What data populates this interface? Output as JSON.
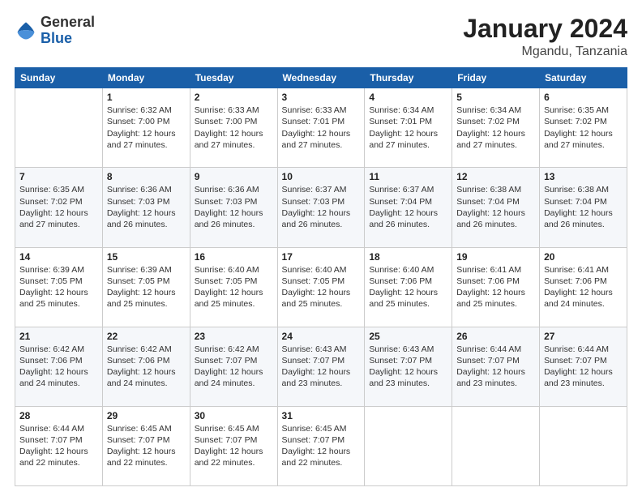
{
  "header": {
    "logo_general": "General",
    "logo_blue": "Blue",
    "month_title": "January 2024",
    "location": "Mgandu, Tanzania"
  },
  "days_of_week": [
    "Sunday",
    "Monday",
    "Tuesday",
    "Wednesday",
    "Thursday",
    "Friday",
    "Saturday"
  ],
  "weeks": [
    [
      {
        "day": "",
        "sunrise": "",
        "sunset": "",
        "daylight": ""
      },
      {
        "day": "1",
        "sunrise": "Sunrise: 6:32 AM",
        "sunset": "Sunset: 7:00 PM",
        "daylight": "Daylight: 12 hours and 27 minutes."
      },
      {
        "day": "2",
        "sunrise": "Sunrise: 6:33 AM",
        "sunset": "Sunset: 7:00 PM",
        "daylight": "Daylight: 12 hours and 27 minutes."
      },
      {
        "day": "3",
        "sunrise": "Sunrise: 6:33 AM",
        "sunset": "Sunset: 7:01 PM",
        "daylight": "Daylight: 12 hours and 27 minutes."
      },
      {
        "day": "4",
        "sunrise": "Sunrise: 6:34 AM",
        "sunset": "Sunset: 7:01 PM",
        "daylight": "Daylight: 12 hours and 27 minutes."
      },
      {
        "day": "5",
        "sunrise": "Sunrise: 6:34 AM",
        "sunset": "Sunset: 7:02 PM",
        "daylight": "Daylight: 12 hours and 27 minutes."
      },
      {
        "day": "6",
        "sunrise": "Sunrise: 6:35 AM",
        "sunset": "Sunset: 7:02 PM",
        "daylight": "Daylight: 12 hours and 27 minutes."
      }
    ],
    [
      {
        "day": "7",
        "sunrise": "Sunrise: 6:35 AM",
        "sunset": "Sunset: 7:02 PM",
        "daylight": "Daylight: 12 hours and 27 minutes."
      },
      {
        "day": "8",
        "sunrise": "Sunrise: 6:36 AM",
        "sunset": "Sunset: 7:03 PM",
        "daylight": "Daylight: 12 hours and 26 minutes."
      },
      {
        "day": "9",
        "sunrise": "Sunrise: 6:36 AM",
        "sunset": "Sunset: 7:03 PM",
        "daylight": "Daylight: 12 hours and 26 minutes."
      },
      {
        "day": "10",
        "sunrise": "Sunrise: 6:37 AM",
        "sunset": "Sunset: 7:03 PM",
        "daylight": "Daylight: 12 hours and 26 minutes."
      },
      {
        "day": "11",
        "sunrise": "Sunrise: 6:37 AM",
        "sunset": "Sunset: 7:04 PM",
        "daylight": "Daylight: 12 hours and 26 minutes."
      },
      {
        "day": "12",
        "sunrise": "Sunrise: 6:38 AM",
        "sunset": "Sunset: 7:04 PM",
        "daylight": "Daylight: 12 hours and 26 minutes."
      },
      {
        "day": "13",
        "sunrise": "Sunrise: 6:38 AM",
        "sunset": "Sunset: 7:04 PM",
        "daylight": "Daylight: 12 hours and 26 minutes."
      }
    ],
    [
      {
        "day": "14",
        "sunrise": "Sunrise: 6:39 AM",
        "sunset": "Sunset: 7:05 PM",
        "daylight": "Daylight: 12 hours and 25 minutes."
      },
      {
        "day": "15",
        "sunrise": "Sunrise: 6:39 AM",
        "sunset": "Sunset: 7:05 PM",
        "daylight": "Daylight: 12 hours and 25 minutes."
      },
      {
        "day": "16",
        "sunrise": "Sunrise: 6:40 AM",
        "sunset": "Sunset: 7:05 PM",
        "daylight": "Daylight: 12 hours and 25 minutes."
      },
      {
        "day": "17",
        "sunrise": "Sunrise: 6:40 AM",
        "sunset": "Sunset: 7:05 PM",
        "daylight": "Daylight: 12 hours and 25 minutes."
      },
      {
        "day": "18",
        "sunrise": "Sunrise: 6:40 AM",
        "sunset": "Sunset: 7:06 PM",
        "daylight": "Daylight: 12 hours and 25 minutes."
      },
      {
        "day": "19",
        "sunrise": "Sunrise: 6:41 AM",
        "sunset": "Sunset: 7:06 PM",
        "daylight": "Daylight: 12 hours and 25 minutes."
      },
      {
        "day": "20",
        "sunrise": "Sunrise: 6:41 AM",
        "sunset": "Sunset: 7:06 PM",
        "daylight": "Daylight: 12 hours and 24 minutes."
      }
    ],
    [
      {
        "day": "21",
        "sunrise": "Sunrise: 6:42 AM",
        "sunset": "Sunset: 7:06 PM",
        "daylight": "Daylight: 12 hours and 24 minutes."
      },
      {
        "day": "22",
        "sunrise": "Sunrise: 6:42 AM",
        "sunset": "Sunset: 7:06 PM",
        "daylight": "Daylight: 12 hours and 24 minutes."
      },
      {
        "day": "23",
        "sunrise": "Sunrise: 6:42 AM",
        "sunset": "Sunset: 7:07 PM",
        "daylight": "Daylight: 12 hours and 24 minutes."
      },
      {
        "day": "24",
        "sunrise": "Sunrise: 6:43 AM",
        "sunset": "Sunset: 7:07 PM",
        "daylight": "Daylight: 12 hours and 23 minutes."
      },
      {
        "day": "25",
        "sunrise": "Sunrise: 6:43 AM",
        "sunset": "Sunset: 7:07 PM",
        "daylight": "Daylight: 12 hours and 23 minutes."
      },
      {
        "day": "26",
        "sunrise": "Sunrise: 6:44 AM",
        "sunset": "Sunset: 7:07 PM",
        "daylight": "Daylight: 12 hours and 23 minutes."
      },
      {
        "day": "27",
        "sunrise": "Sunrise: 6:44 AM",
        "sunset": "Sunset: 7:07 PM",
        "daylight": "Daylight: 12 hours and 23 minutes."
      }
    ],
    [
      {
        "day": "28",
        "sunrise": "Sunrise: 6:44 AM",
        "sunset": "Sunset: 7:07 PM",
        "daylight": "Daylight: 12 hours and 22 minutes."
      },
      {
        "day": "29",
        "sunrise": "Sunrise: 6:45 AM",
        "sunset": "Sunset: 7:07 PM",
        "daylight": "Daylight: 12 hours and 22 minutes."
      },
      {
        "day": "30",
        "sunrise": "Sunrise: 6:45 AM",
        "sunset": "Sunset: 7:07 PM",
        "daylight": "Daylight: 12 hours and 22 minutes."
      },
      {
        "day": "31",
        "sunrise": "Sunrise: 6:45 AM",
        "sunset": "Sunset: 7:07 PM",
        "daylight": "Daylight: 12 hours and 22 minutes."
      },
      {
        "day": "",
        "sunrise": "",
        "sunset": "",
        "daylight": ""
      },
      {
        "day": "",
        "sunrise": "",
        "sunset": "",
        "daylight": ""
      },
      {
        "day": "",
        "sunrise": "",
        "sunset": "",
        "daylight": ""
      }
    ]
  ],
  "accent_color": "#1a5fa8"
}
